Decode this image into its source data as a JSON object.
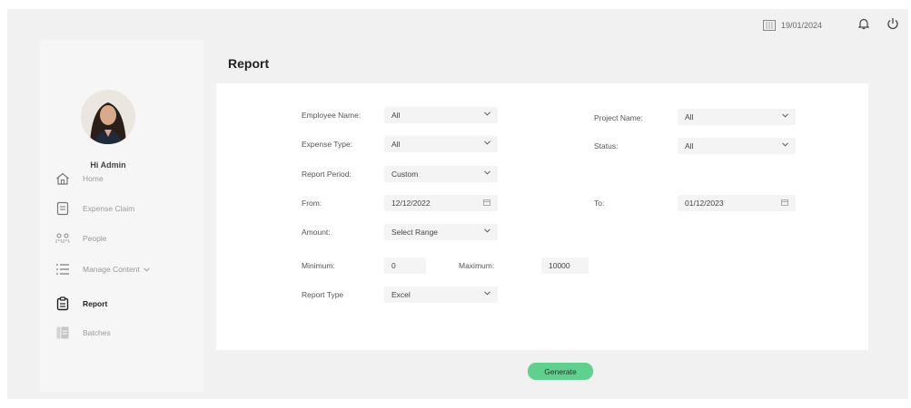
{
  "topbar": {
    "date": "19/01/2024",
    "icons": [
      "calendar-icon",
      "bell-icon",
      "power-icon"
    ]
  },
  "sidebar": {
    "greeting": "Hi Admin",
    "items": [
      {
        "label": "Home",
        "icon": "home-icon"
      },
      {
        "label": "Expense Claim",
        "icon": "document-icon"
      },
      {
        "label": "People",
        "icon": "people-icon"
      },
      {
        "label": "Manage Content",
        "icon": "list-icon",
        "has_submenu": true
      },
      {
        "label": "Report",
        "icon": "report-icon",
        "active": true
      },
      {
        "label": "Batches",
        "icon": "batches-icon"
      }
    ]
  },
  "main": {
    "title": "Report",
    "form": {
      "employee_name": {
        "label": "Employee Name:",
        "value": "All"
      },
      "project_name": {
        "label": "Project Name:",
        "value": "All"
      },
      "expense_type": {
        "label": "Expense Type:",
        "value": "All"
      },
      "status": {
        "label": "Status:",
        "value": "All"
      },
      "report_period": {
        "label": "Report Period:",
        "value": "Custom"
      },
      "from": {
        "label": "From:",
        "value": "12/12/2022"
      },
      "to": {
        "label": "To:",
        "value": "01/12/2023"
      },
      "amount": {
        "label": "Amount:",
        "value": "Select Range"
      },
      "minimum": {
        "label": "Minimum:",
        "value": "0"
      },
      "maximum": {
        "label": "Maximum:",
        "value": "10000"
      },
      "report_type": {
        "label": "Report Type",
        "value": "Excel"
      }
    },
    "generate_label": "Generate"
  },
  "colors": {
    "accent": "#5fd08d",
    "background": "#f1f1f1",
    "card": "#ffffff"
  }
}
